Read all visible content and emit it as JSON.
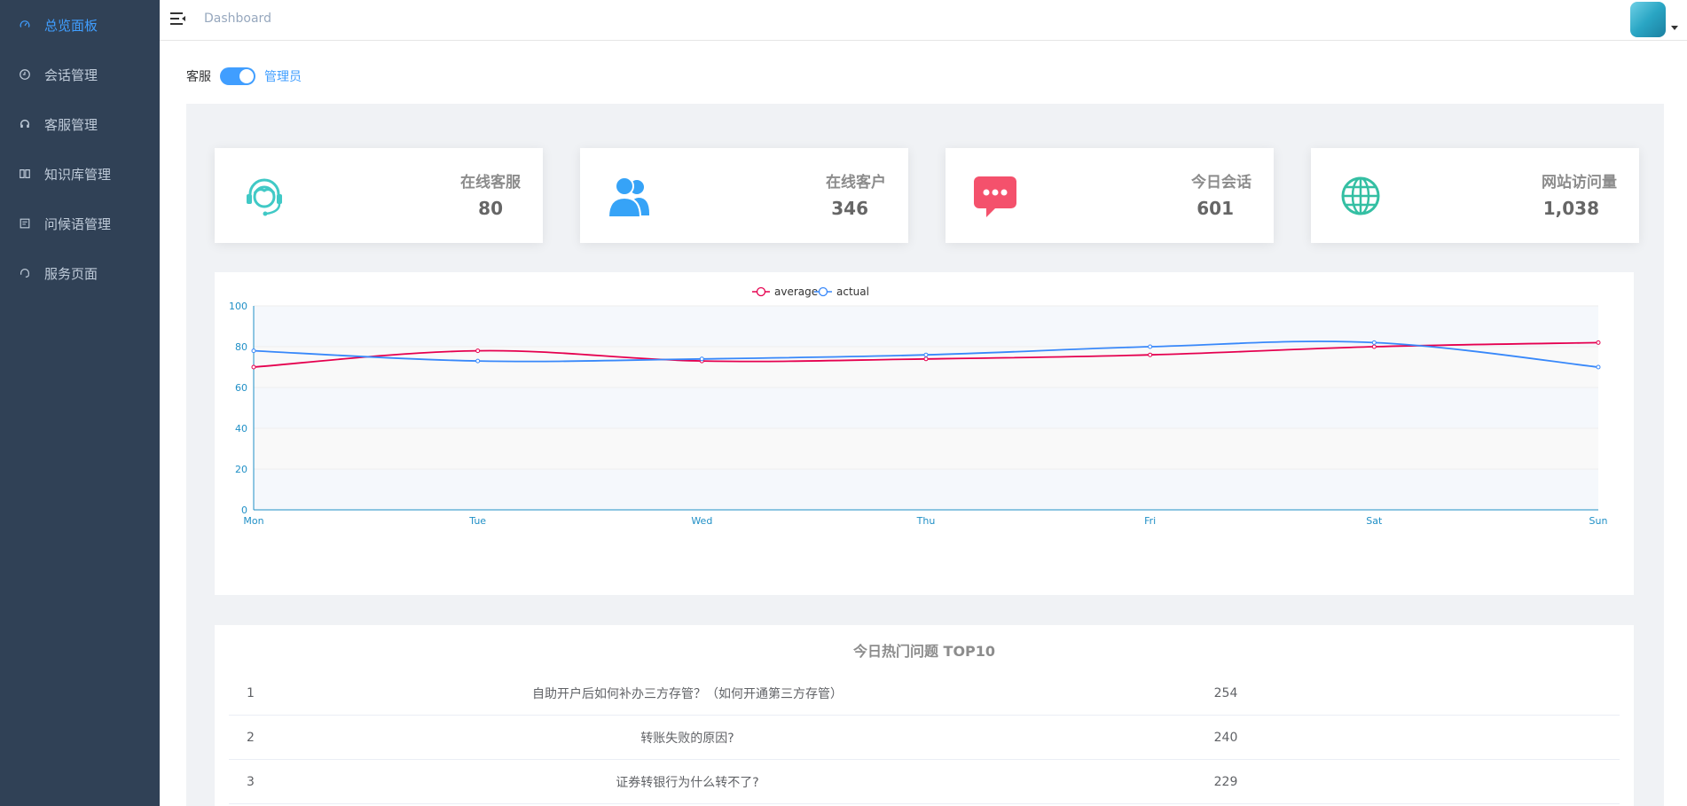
{
  "sidebar": {
    "items": [
      {
        "label": "总览面板",
        "icon": "dashboard-icon",
        "active": true
      },
      {
        "label": "会话管理",
        "icon": "clock-icon",
        "active": false
      },
      {
        "label": "客服管理",
        "icon": "headset-icon",
        "active": false
      },
      {
        "label": "知识库管理",
        "icon": "book-icon",
        "active": false
      },
      {
        "label": "问候语管理",
        "icon": "message-box-icon",
        "active": false
      },
      {
        "label": "服务页面",
        "icon": "service-icon",
        "active": false
      }
    ]
  },
  "header": {
    "breadcrumb": "Dashboard"
  },
  "role_toggle": {
    "left_label": "客服",
    "right_label": "管理员",
    "state": "管理员"
  },
  "stats": [
    {
      "title": "在线客服",
      "value": "80",
      "icon": "customer-service-icon",
      "color": "#40c9c6"
    },
    {
      "title": "在线客户",
      "value": "346",
      "icon": "people-icon",
      "color": "#36a3f7"
    },
    {
      "title": "今日会话",
      "value": "601",
      "icon": "chat-bubble-icon",
      "color": "#f4516c"
    },
    {
      "title": "网站访问量",
      "value": "1,038",
      "icon": "globe-icon",
      "color": "#34bfa3"
    }
  ],
  "chart_data": {
    "type": "line",
    "categories": [
      "Mon",
      "Tue",
      "Wed",
      "Thu",
      "Fri",
      "Sat",
      "Sun"
    ],
    "series": [
      {
        "name": "average",
        "values": [
          70,
          78,
          73,
          74,
          76,
          80,
          82
        ],
        "color": "#e5004f"
      },
      {
        "name": "actual",
        "values": [
          78,
          73,
          74,
          76,
          80,
          82,
          70
        ],
        "color": "#3888fa"
      }
    ],
    "ylim": [
      0,
      100
    ],
    "yticks": [
      0,
      20,
      40,
      60,
      80,
      100
    ],
    "legend": "top-center",
    "grid": true
  },
  "hot_questions": {
    "title": "今日热门问题 TOP10",
    "rows": [
      {
        "rank": "1",
        "question": "自助开户后如何补办三方存管？（如何开通第三方存管）",
        "count": "254"
      },
      {
        "rank": "2",
        "question": "转账失败的原因?",
        "count": "240"
      },
      {
        "rank": "3",
        "question": "证券转银行为什么转不了?",
        "count": "229"
      }
    ]
  }
}
